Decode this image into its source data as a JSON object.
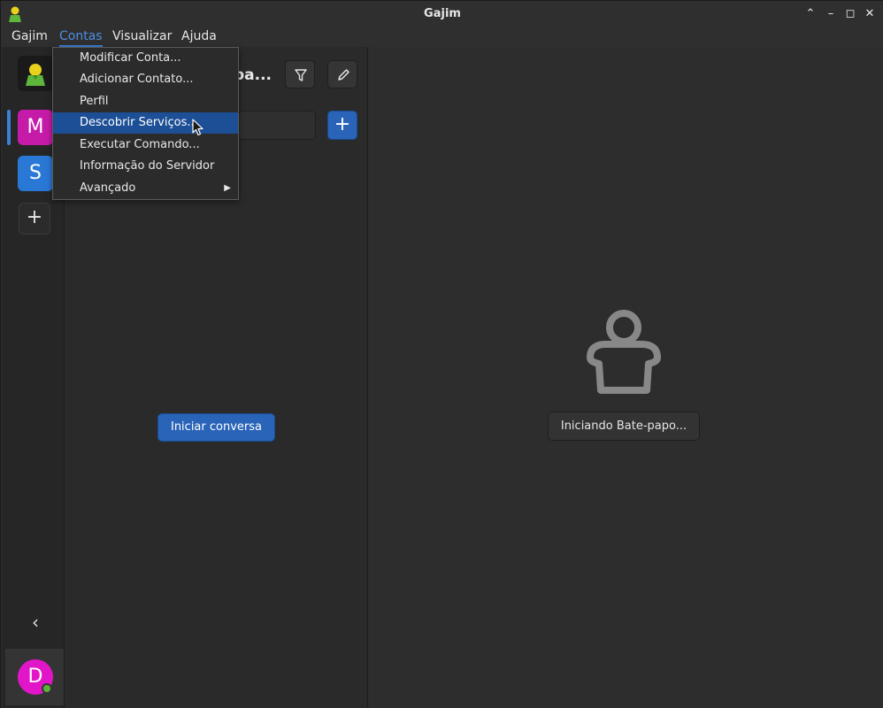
{
  "window": {
    "title": "Gajim"
  },
  "menubar": {
    "items": [
      "Gajim",
      "Contas",
      "Visualizar",
      "Ajuda"
    ],
    "active": "Contas"
  },
  "accounts": {
    "items": [
      {
        "letter": "M",
        "color": "#c61ba8"
      },
      {
        "letter": "S",
        "color": "#2a78d6"
      }
    ],
    "add_label": "+",
    "collapse_label": "‹",
    "me": {
      "letter": "D",
      "color": "#e116c8",
      "status_color": "#5ab43a"
    }
  },
  "middle": {
    "title": "pa...",
    "add_label": "+",
    "start_chat_label": "Iniciar conversa"
  },
  "right": {
    "status_label": "Iniciando Bate-papo..."
  },
  "dropdown": {
    "items": [
      {
        "label": "Modificar Conta..."
      },
      {
        "label": "Adicionar Contato..."
      },
      {
        "label": "Perfil"
      },
      {
        "label": "Descobrir Serviços..."
      },
      {
        "label": "Executar Comando..."
      },
      {
        "label": "Informação do Servidor"
      },
      {
        "label": "Avançado",
        "submenu": true
      }
    ],
    "selected": "Descobrir Serviços..."
  },
  "colors": {
    "accent": "#2a64b8",
    "menu_highlight": "#1d4f96"
  }
}
